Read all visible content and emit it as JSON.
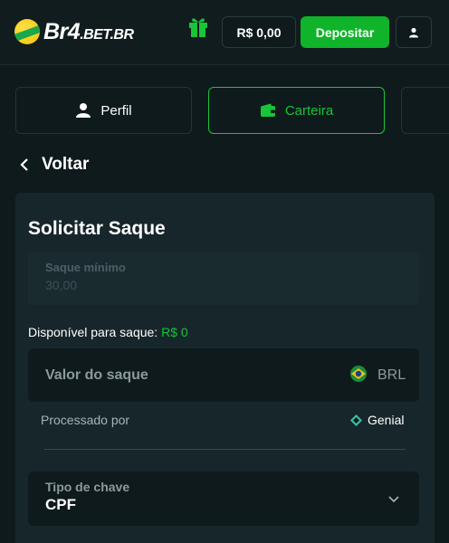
{
  "header": {
    "logo_main": "Br4",
    "logo_suffix": ".BET.BR",
    "balance": "R$ 0,00",
    "deposit_label": "Depositar"
  },
  "tabs": [
    {
      "label": "Perfil",
      "icon": "person-icon",
      "active": false
    },
    {
      "label": "Carteira",
      "icon": "wallet-icon",
      "active": true
    }
  ],
  "back_label": "Voltar",
  "withdraw": {
    "title": "Solicitar Saque",
    "min_label": "Saque mínimo",
    "min_value": "30,00",
    "available_label": "Disponível para saque:",
    "available_amount": "R$ 0",
    "amount_placeholder": "Valor do saque",
    "currency": "BRL",
    "processed_label": "Processado por",
    "provider": "Genial",
    "keytype_label": "Tipo de chave",
    "keytype_value": "CPF"
  },
  "colors": {
    "accent": "#10b42a",
    "background": "#0f1a1d",
    "card": "#17262a"
  }
}
